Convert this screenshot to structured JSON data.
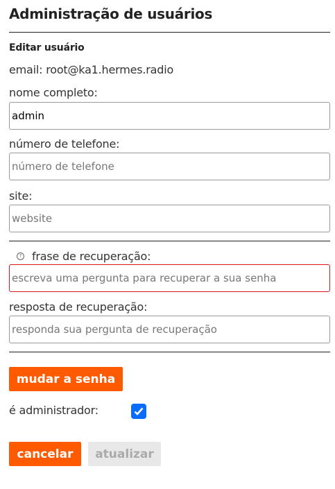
{
  "title": "Administração de usuários",
  "subtitle": "Editar usuário",
  "email_line": "email: root@ka1.hermes.radio",
  "fields": {
    "full_name": {
      "label": "nome completo:",
      "value": "admin",
      "placeholder": ""
    },
    "phone": {
      "label": "número de telefone:",
      "value": "",
      "placeholder": "número de telefone"
    },
    "site": {
      "label": "site:",
      "value": "",
      "placeholder": "website"
    },
    "recovery_question": {
      "label": "frase de recuperação:",
      "value": "",
      "placeholder": "escreva uma pergunta para recuperar a sua senha"
    },
    "recovery_answer": {
      "label": "resposta de recuperação:",
      "value": "",
      "placeholder": "responda sua pergunta de recuperação"
    }
  },
  "change_password_label": "mudar a senha",
  "is_admin": {
    "label": "é administrador:",
    "checked": true
  },
  "cancel_label": "cancelar",
  "update_label": "atualizar",
  "colors": {
    "accent": "#ff5a00",
    "checkbox": "#0a6cff",
    "error": "#e0141e"
  }
}
